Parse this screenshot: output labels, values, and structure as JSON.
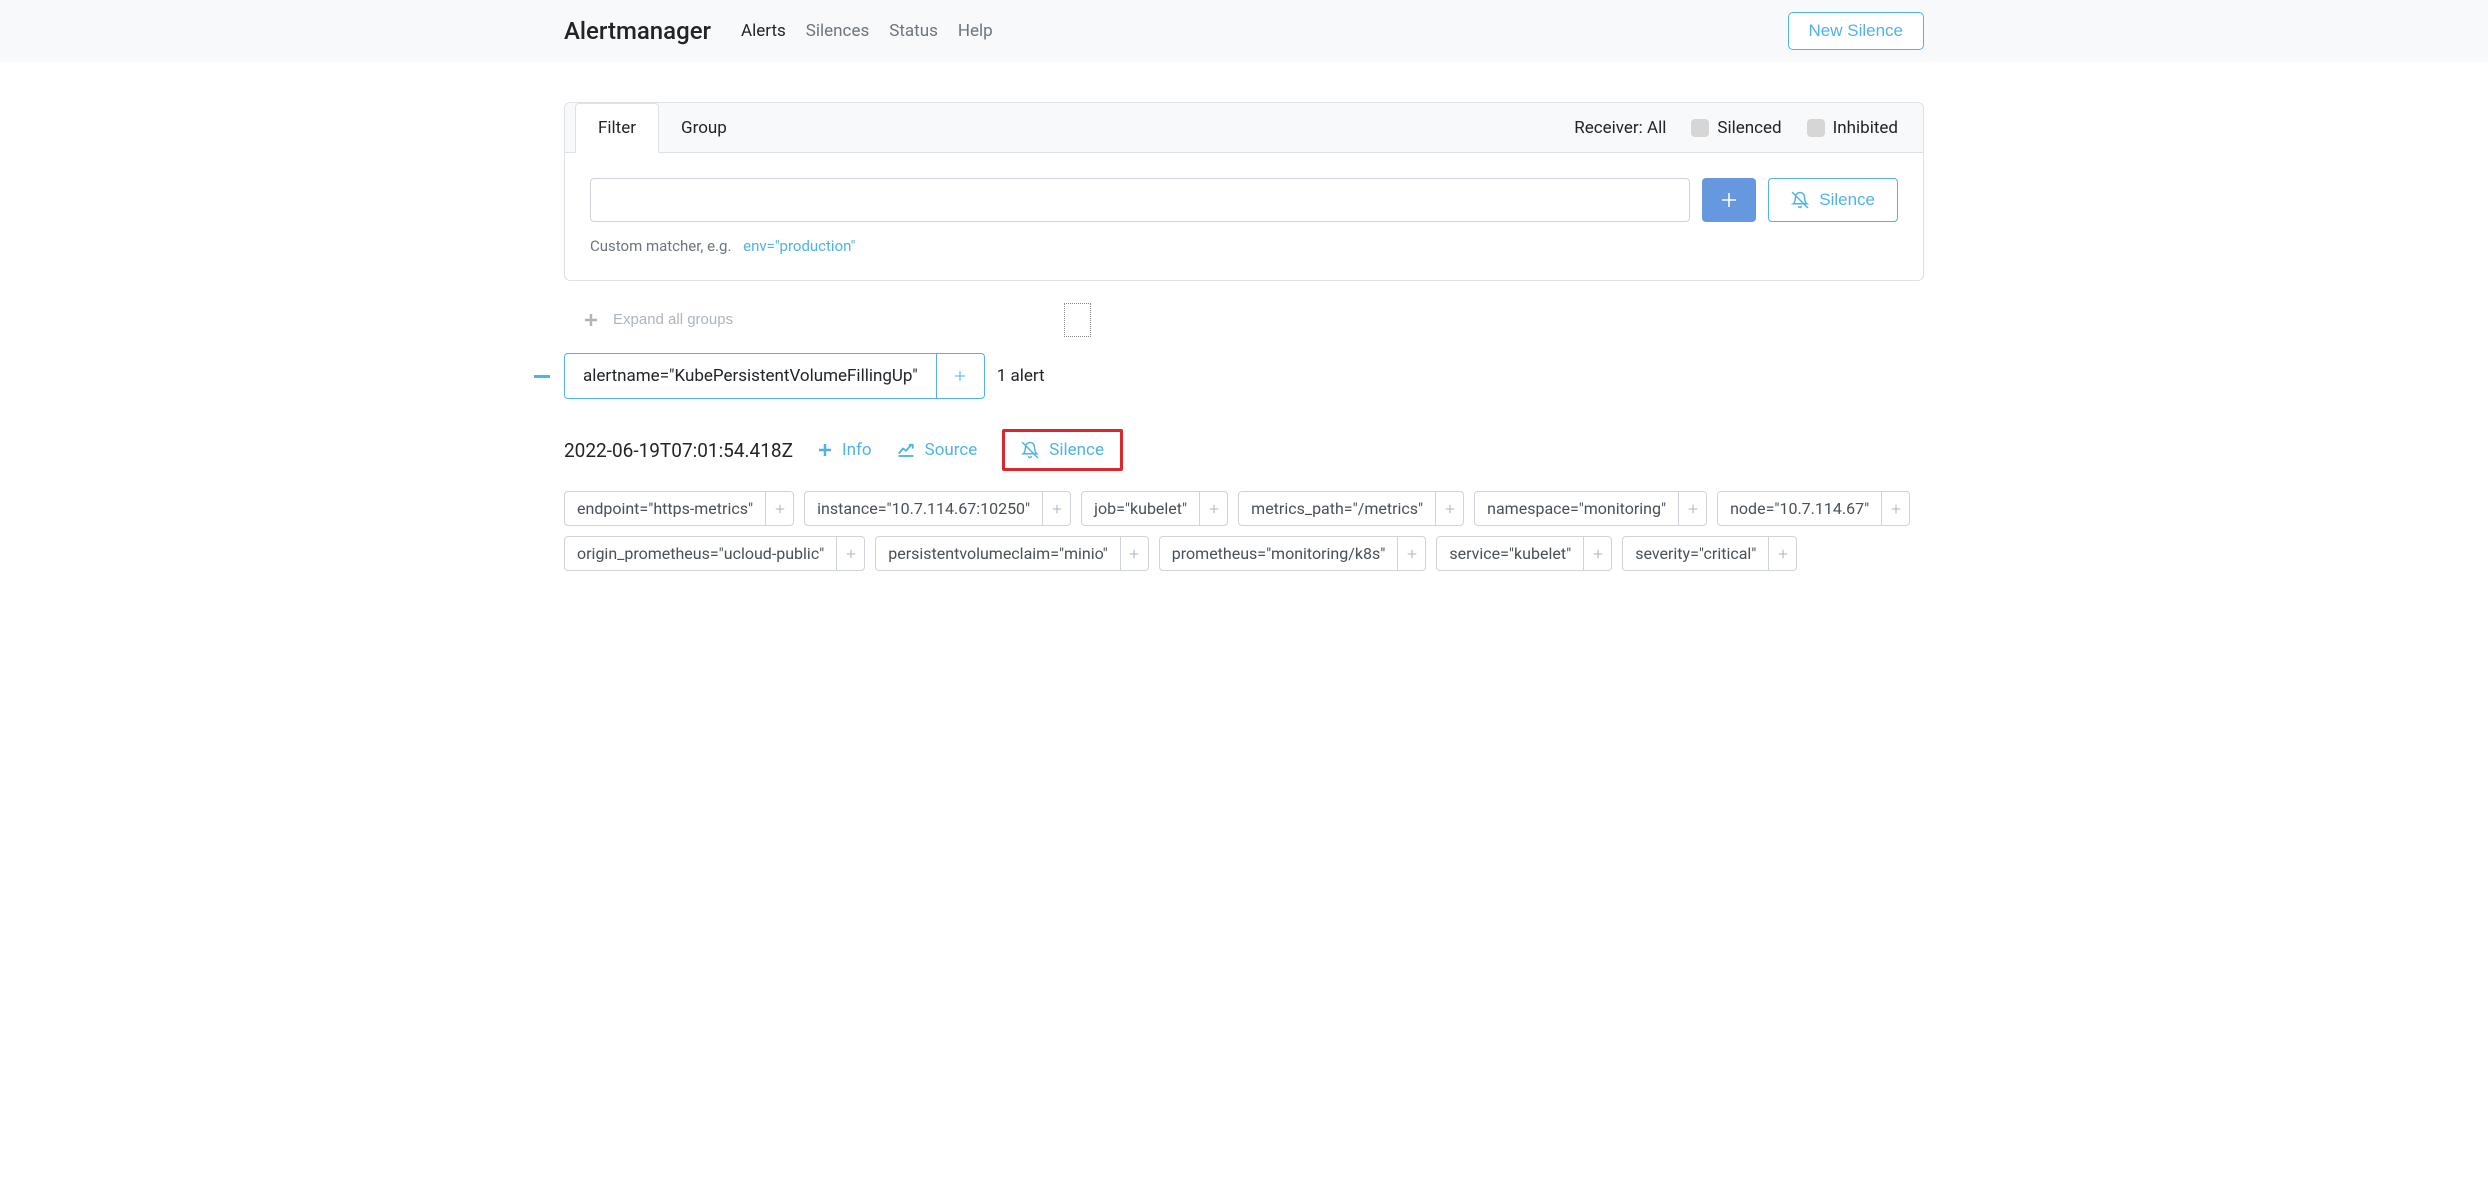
{
  "navbar": {
    "brand": "Alertmanager",
    "items": [
      "Alerts",
      "Silences",
      "Status",
      "Help"
    ],
    "active_index": 0,
    "new_silence": "New Silence"
  },
  "card": {
    "tabs": [
      "Filter",
      "Group"
    ],
    "active_tab": 0,
    "receiver_label": "Receiver: All",
    "silenced_label": "Silenced",
    "inhibited_label": "Inhibited",
    "filter_value": "",
    "matcher_hint_prefix": "Custom matcher, e.g.",
    "matcher_hint_example": "env=\"production\"",
    "silence_btn": "Silence"
  },
  "expand": {
    "label": "Expand all groups"
  },
  "group": {
    "tag": "alertname=\"KubePersistentVolumeFillingUp\"",
    "count": "1 alert"
  },
  "alert": {
    "timestamp": "2022-06-19T07:01:54.418Z",
    "actions": {
      "info": "Info",
      "source": "Source",
      "silence": "Silence"
    },
    "labels": [
      "endpoint=\"https-metrics\"",
      "instance=\"10.7.114.67:10250\"",
      "job=\"kubelet\"",
      "metrics_path=\"/metrics\"",
      "namespace=\"monitoring\"",
      "node=\"10.7.114.67\"",
      "origin_prometheus=\"ucloud-public\"",
      "persistentvolumeclaim=\"minio\"",
      "prometheus=\"monitoring/k8s\"",
      "service=\"kubelet\"",
      "severity=\"critical\""
    ]
  }
}
